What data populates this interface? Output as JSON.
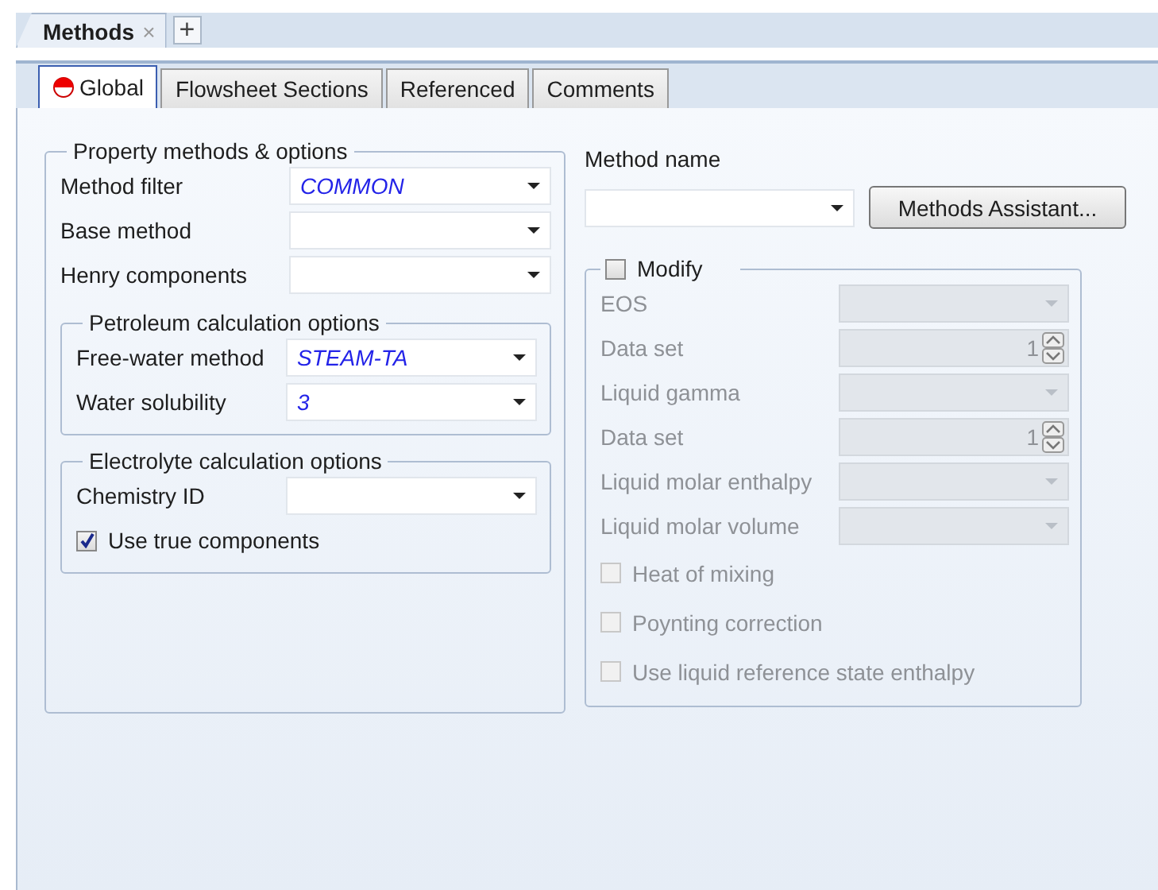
{
  "document_tabs": [
    {
      "label": "Methods",
      "close": "×"
    }
  ],
  "new_tab": "+",
  "tabs": [
    {
      "label": "Global",
      "selected": true,
      "incomplete": true
    },
    {
      "label": "Flowsheet Sections",
      "selected": false,
      "incomplete": false
    },
    {
      "label": "Referenced",
      "selected": false,
      "incomplete": false
    },
    {
      "label": "Comments",
      "selected": false,
      "incomplete": false
    }
  ],
  "property_methods": {
    "title": "Property methods & options",
    "fields": [
      {
        "label": "Method filter",
        "value": "COMMON"
      },
      {
        "label": "Base method"
      },
      {
        "label": "Henry components"
      }
    ],
    "petroleum": {
      "title": "Petroleum calculation options",
      "fields": [
        {
          "label": "Free-water method",
          "value": "STEAM-TA"
        },
        {
          "label": "Water solubility",
          "value": "3"
        }
      ]
    },
    "electrolyte": {
      "title": "Electrolyte calculation options",
      "fields": [
        {
          "label": "Chemistry ID"
        }
      ],
      "checkbox": {
        "label": "Use true components",
        "checked": true
      }
    }
  },
  "method_name": {
    "label": "Method name",
    "button": "Methods Assistant..."
  },
  "modify": {
    "label": "Modify",
    "checked": false,
    "fields": [
      {
        "kind": "dropdown",
        "label": "EOS",
        "disabled": true
      },
      {
        "kind": "spinner",
        "label": "Data set",
        "value": "1",
        "disabled": true
      },
      {
        "kind": "dropdown",
        "label": "Liquid gamma",
        "disabled": true
      },
      {
        "kind": "spinner",
        "label": "Data set",
        "value": "1",
        "disabled": true
      },
      {
        "kind": "dropdown",
        "label": "Liquid molar enthalpy",
        "disabled": true
      },
      {
        "kind": "dropdown",
        "label": "Liquid molar volume",
        "disabled": true
      },
      {
        "kind": "checkbox",
        "label": "Heat of mixing",
        "checked": false,
        "disabled": true
      },
      {
        "kind": "checkbox",
        "label": "Poynting correction",
        "checked": false,
        "disabled": true
      },
      {
        "kind": "checkbox",
        "label": "Use liquid reference state enthalpy",
        "checked": false,
        "disabled": true
      }
    ]
  }
}
